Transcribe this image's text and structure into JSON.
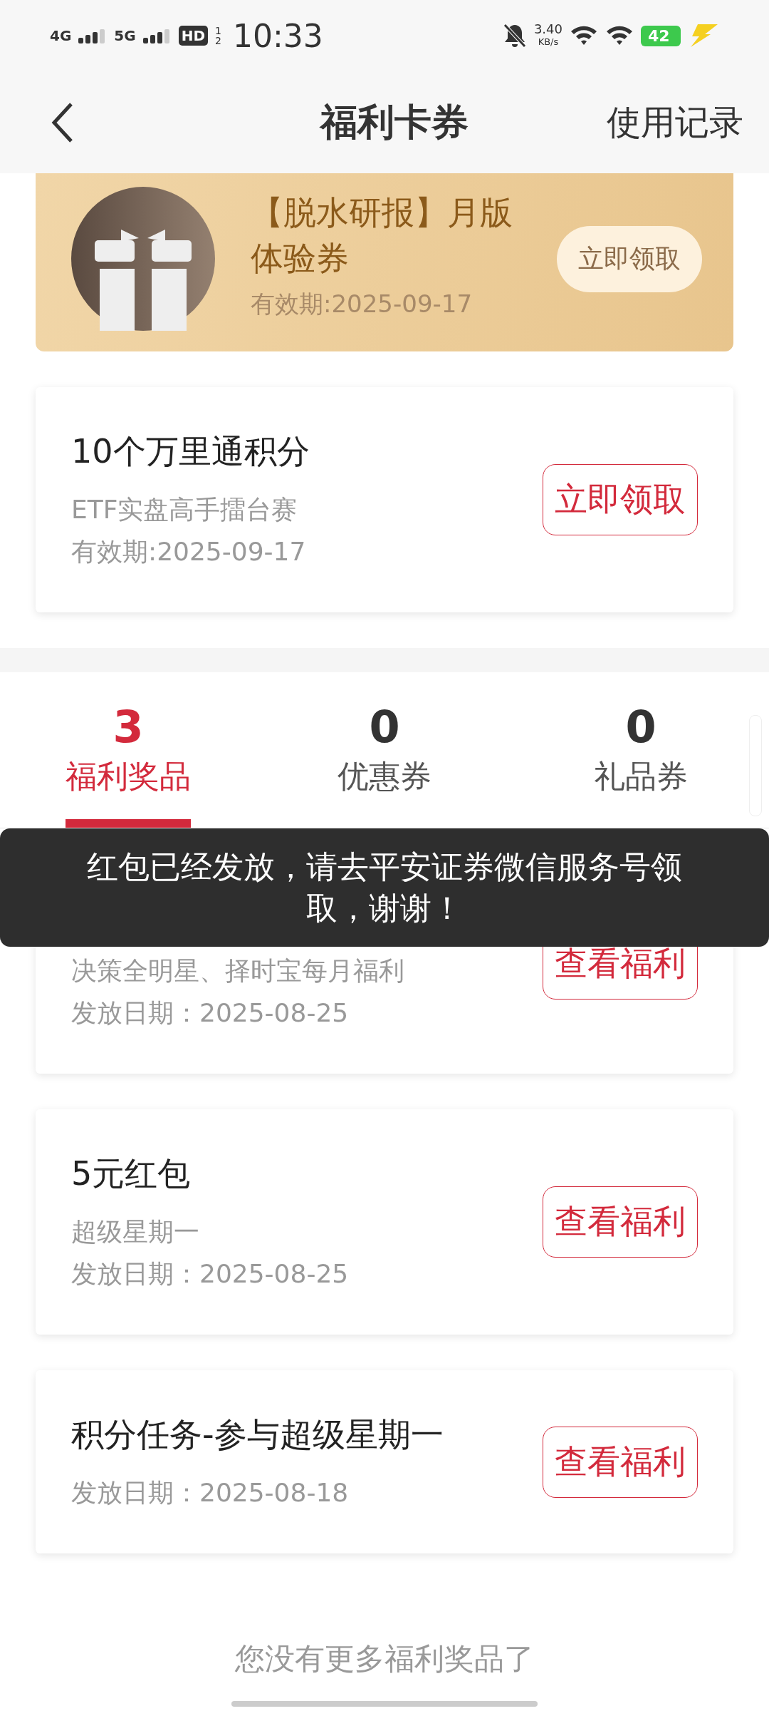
{
  "status_bar": {
    "signals": [
      "4G",
      "5G"
    ],
    "hd": "HD",
    "hd_slots": [
      "1",
      "2"
    ],
    "time": "10:33",
    "speed": "3.40",
    "speed_unit": "KB/s",
    "battery": "42",
    "charging": true
  },
  "nav": {
    "title": "福利卡券",
    "action": "使用记录"
  },
  "featured_coupon": {
    "title": "【脱水研报】月版体验券",
    "validity": "有效期:2025-09-17",
    "button": "立即领取"
  },
  "coupons": [
    {
      "title": "10个万里通积分",
      "lines": [
        "ETF实盘高手擂台赛",
        "有效期:2025-09-17"
      ],
      "button": "立即领取"
    }
  ],
  "tabs": [
    {
      "count": "3",
      "label": "福利奖品",
      "selected": true
    },
    {
      "count": "0",
      "label": "优惠券",
      "selected": false
    },
    {
      "count": "0",
      "label": "礼品券",
      "selected": false
    }
  ],
  "rewards": [
    {
      "lines": [
        "决策全明星、择时宝每月福利",
        "发放日期：2025-08-25"
      ],
      "button": "查看福利"
    },
    {
      "title": "5元红包",
      "lines": [
        "超级星期一",
        "发放日期：2025-08-25"
      ],
      "button": "查看福利"
    },
    {
      "title": "积分任务-参与超级星期一",
      "lines": [
        "发放日期：2025-08-18"
      ],
      "button": "查看福利"
    }
  ],
  "footer": "您没有更多福利奖品了",
  "toast": "红包已经发放，请去平安证券微信服务号领取，谢谢！"
}
